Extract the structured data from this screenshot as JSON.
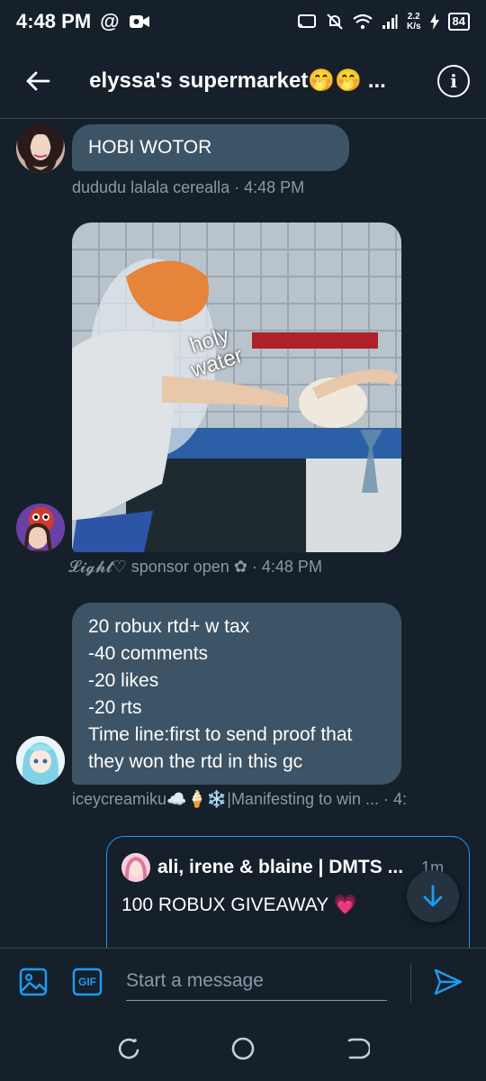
{
  "status_bar": {
    "time": "4:48 PM",
    "speed_top": "2.2",
    "speed_bottom": "K/s",
    "battery": "84"
  },
  "header": {
    "title": "elyssa's supermarket🤭🤭 ...",
    "back_icon": "arrow-left-icon",
    "info_icon": "info-icon"
  },
  "messages": [
    {
      "text": "HOBI WOTOR",
      "meta": "dududu lalala cerealla · 4:48 PM"
    },
    {
      "image_caption": "holy\nwater",
      "meta": "𝓛𝓲𝓰𝓱𝓽♡ sponsor open ✿ · 4:48 PM"
    },
    {
      "lines": [
        "20 robux rtd+ w tax",
        "-40 comments",
        "-20 likes",
        "-20 rts",
        "Time line:first to send proof that",
        "they won the rtd in this gc"
      ],
      "meta": "iceycreamiku☁️🍦❄️|Manifesting to win ... · 4:"
    }
  ],
  "quoted": {
    "author": "ali, irene & blaine | DMTS ...",
    "time": "1m",
    "text": "100 ROBUX GIVEAWAY 💗"
  },
  "composer": {
    "placeholder": "Start a message",
    "gif_label": "GIF"
  },
  "colors": {
    "background": "#15202b",
    "bubble": "#3d5466",
    "accent": "#1d9bf0",
    "muted": "#8899a6"
  }
}
